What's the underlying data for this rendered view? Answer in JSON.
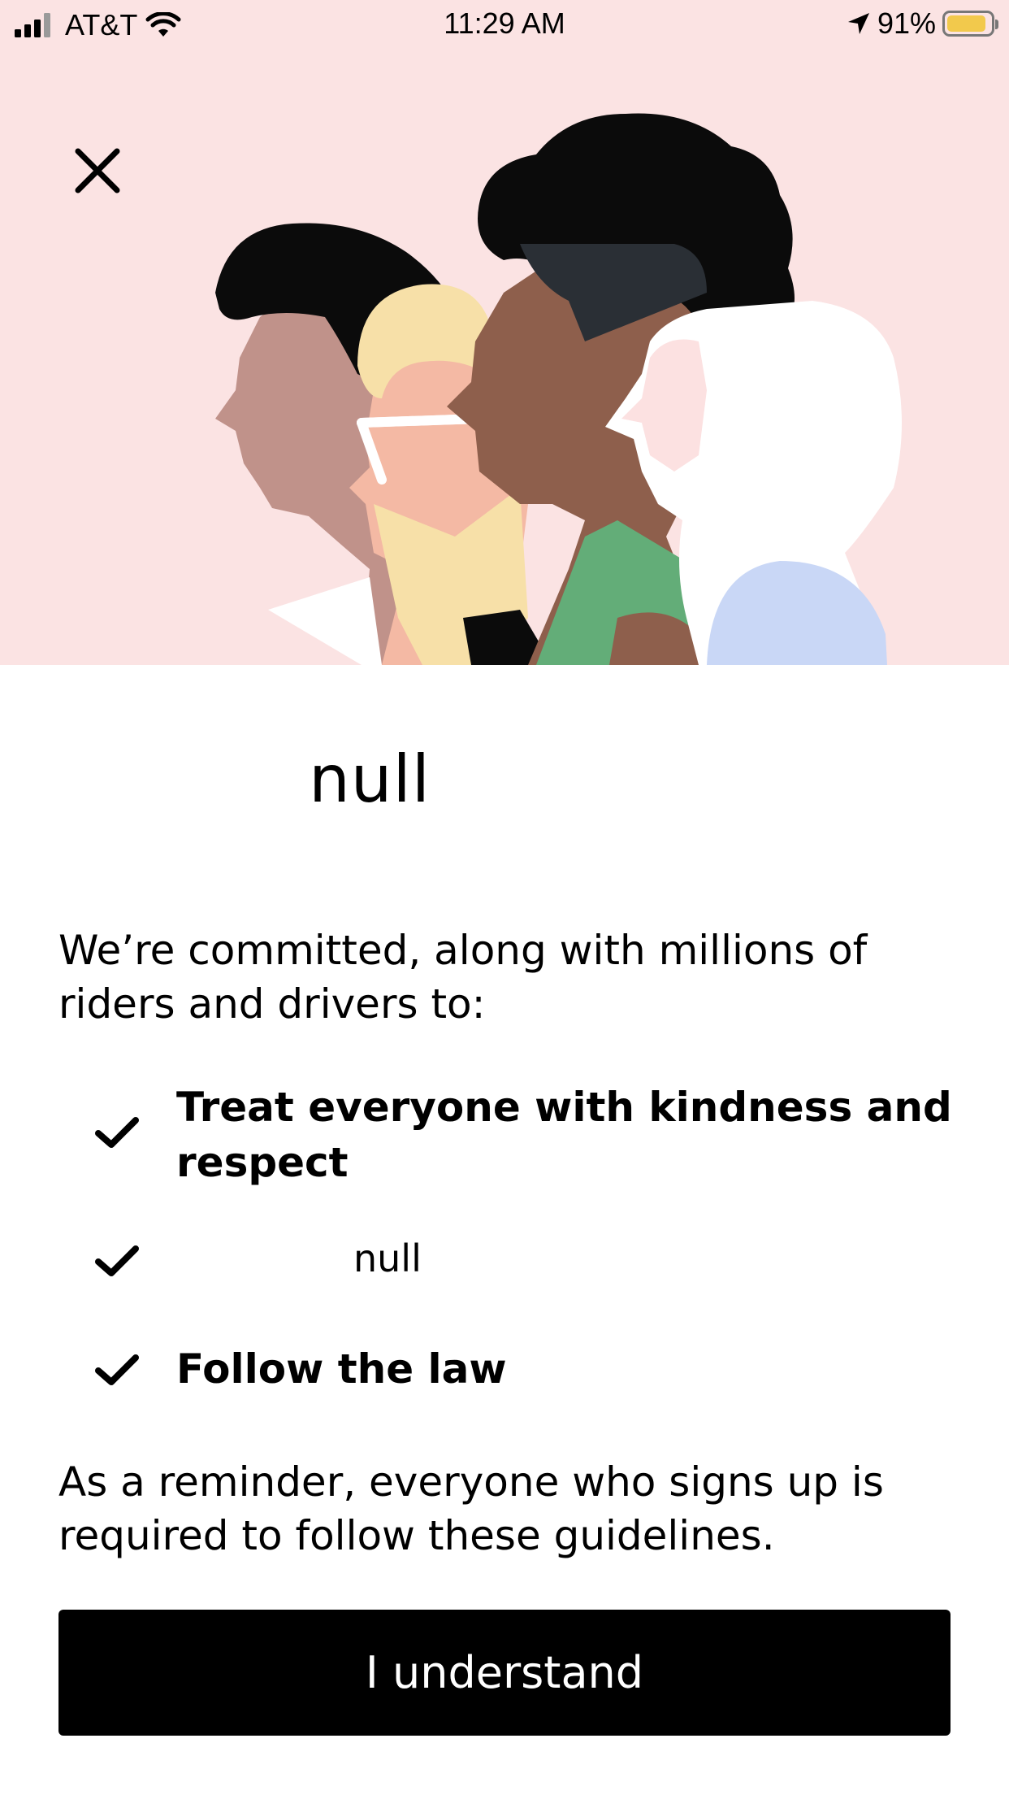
{
  "status_bar": {
    "carrier": "AT&T",
    "time": "11:29 AM",
    "battery_percent": "91%",
    "battery_level": 0.91,
    "icons": [
      "signal-icon",
      "wifi-icon",
      "location-arrow-icon",
      "battery-icon"
    ]
  },
  "hero": {
    "close_icon": "close-icon"
  },
  "main": {
    "title": "null",
    "intro": "We’re committed, along with millions of riders and drivers to:",
    "checklist": [
      {
        "icon": "check-icon",
        "text": "Treat everyone with kindness and respect"
      },
      {
        "icon": "check-icon",
        "text": "null"
      },
      {
        "icon": "check-icon",
        "text": "Follow the law"
      }
    ],
    "reminder": "As a reminder, everyone who signs up is required to follow these guidelines.",
    "button_label": "I understand"
  },
  "colors": {
    "hero_background": "#fbe3e3",
    "button_background": "#000000",
    "button_text": "#ffffff"
  }
}
